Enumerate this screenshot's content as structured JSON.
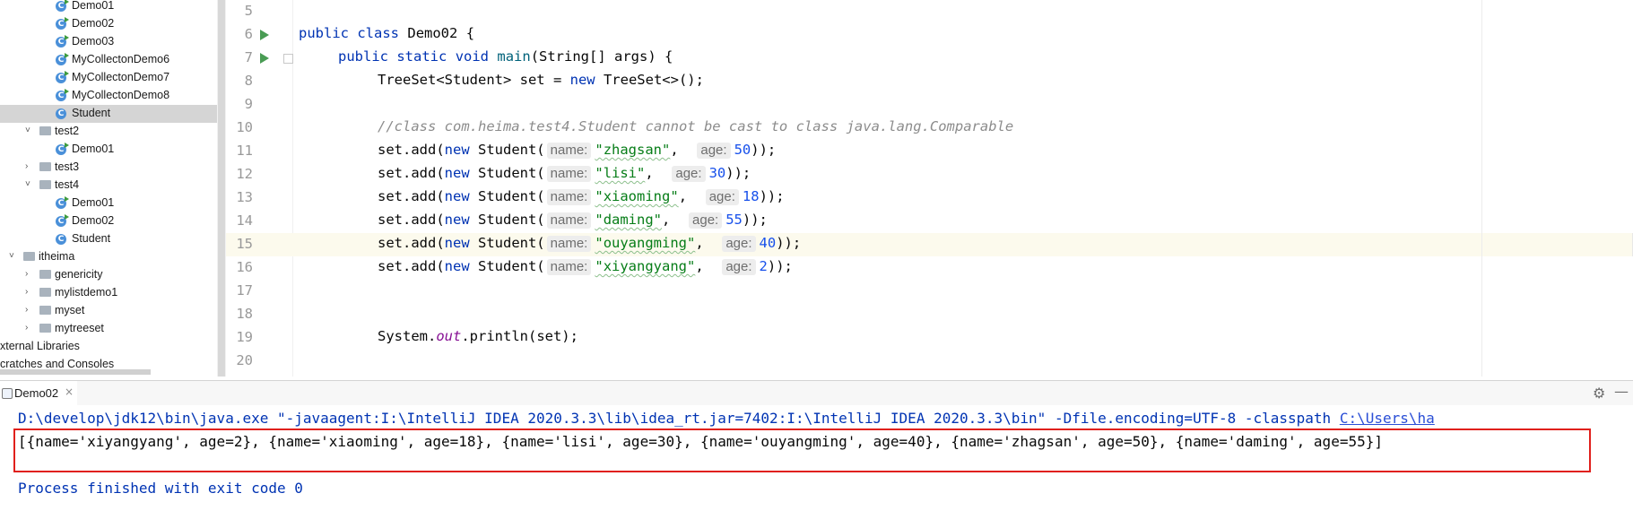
{
  "project_tree": {
    "items": [
      {
        "label": "Demo01",
        "type": "class-run",
        "indent": 3
      },
      {
        "label": "Demo02",
        "type": "class-run",
        "indent": 3
      },
      {
        "label": "Demo03",
        "type": "class-run",
        "indent": 3
      },
      {
        "label": "MyCollectonDemo6",
        "type": "class-run",
        "indent": 3
      },
      {
        "label": "MyCollectonDemo7",
        "type": "class-run",
        "indent": 3
      },
      {
        "label": "MyCollectonDemo8",
        "type": "class-run",
        "indent": 3
      },
      {
        "label": "Student",
        "type": "class",
        "indent": 3,
        "selected": true
      },
      {
        "label": "test2",
        "type": "package",
        "indent": 2,
        "arrow": "˅"
      },
      {
        "label": "Demo01",
        "type": "class-run",
        "indent": 3
      },
      {
        "label": "test3",
        "type": "package",
        "indent": 2,
        "arrow": "›"
      },
      {
        "label": "test4",
        "type": "package",
        "indent": 2,
        "arrow": "˅"
      },
      {
        "label": "Demo01",
        "type": "class-run",
        "indent": 3
      },
      {
        "label": "Demo02",
        "type": "class-run",
        "indent": 3
      },
      {
        "label": "Student",
        "type": "class",
        "indent": 3
      },
      {
        "label": "itheima",
        "type": "package",
        "indent": 1,
        "arrow": "˅"
      },
      {
        "label": "genericity",
        "type": "package",
        "indent": 2,
        "arrow": "›"
      },
      {
        "label": "mylistdemo1",
        "type": "package",
        "indent": 2,
        "arrow": "›"
      },
      {
        "label": "myset",
        "type": "package",
        "indent": 2,
        "arrow": "›"
      },
      {
        "label": "mytreeset",
        "type": "package",
        "indent": 2,
        "arrow": "›"
      },
      {
        "label": "xternal Libraries",
        "type": "root",
        "indent": 0
      },
      {
        "label": "cratches and Consoles",
        "type": "root",
        "indent": 0
      }
    ]
  },
  "editor": {
    "line_numbers": [
      "5",
      "6",
      "7",
      "8",
      "9",
      "10",
      "11",
      "12",
      "13",
      "14",
      "15",
      "16",
      "17",
      "18",
      "19",
      "20"
    ],
    "current_line": "15",
    "lines": {
      "l6": {
        "kw1": "public",
        "kw2": "class",
        "name": "Demo02",
        "brace": "{"
      },
      "l7": {
        "kw1": "public",
        "kw2": "static",
        "kw3": "void",
        "method": "main",
        "params": "(String[] args) {"
      },
      "l8": {
        "type": "TreeSet<Student> set = ",
        "kw": "new",
        "rest": " TreeSet<>();"
      },
      "l10": {
        "comment": "//class com.heima.test4.Student cannot be cast to class java.lang.Comparable"
      },
      "calls": [
        {
          "name": "\"zhagsan\"",
          "age": "50",
          "sep": ",  "
        },
        {
          "name": "\"lisi\"",
          "age": "30",
          "sep": ",  "
        },
        {
          "name": "\"xiaoming\"",
          "age": "18",
          "sep": ",  "
        },
        {
          "name": "\"daming\"",
          "age": "55",
          "sep": ",  "
        },
        {
          "name": "\"ouyangming\"",
          "age": "40",
          "sep": ",  "
        },
        {
          "name": "\"xiyangyang\"",
          "age": "2",
          "sep": ",  "
        }
      ],
      "call_prefix": "set.add(",
      "call_new": "new",
      "call_class": " Student(",
      "call_suffix": "));",
      "hint_name": "name:",
      "hint_age": "age:",
      "l19": {
        "pre": "System.",
        "field": "out",
        "post": ".println(set);"
      }
    }
  },
  "run_panel": {
    "tab_label": "Demo02",
    "close_glyph": "×",
    "gear_glyph": "⚙",
    "minimize_glyph": "—",
    "command_text": "D:\\develop\\jdk12\\bin\\java.exe \"-javaagent:I:\\IntelliJ IDEA 2020.3.3\\lib\\idea_rt.jar=7402:I:\\IntelliJ IDEA 2020.3.3\\bin\" -Dfile.encoding=UTF-8 -classpath ",
    "command_link": "C:\\Users\\ha",
    "output": "[{name='xiyangyang', age=2}, {name='xiaoming', age=18}, {name='lisi', age=30}, {name='ouyangming', age=40}, {name='zhagsan', age=50}, {name='daming', age=55}]",
    "exit_message": "Process finished with exit code 0"
  },
  "colors": {
    "highlight_box": "#e0201c",
    "keyword": "#0033b3",
    "string": "#067d17",
    "number": "#1750eb"
  }
}
